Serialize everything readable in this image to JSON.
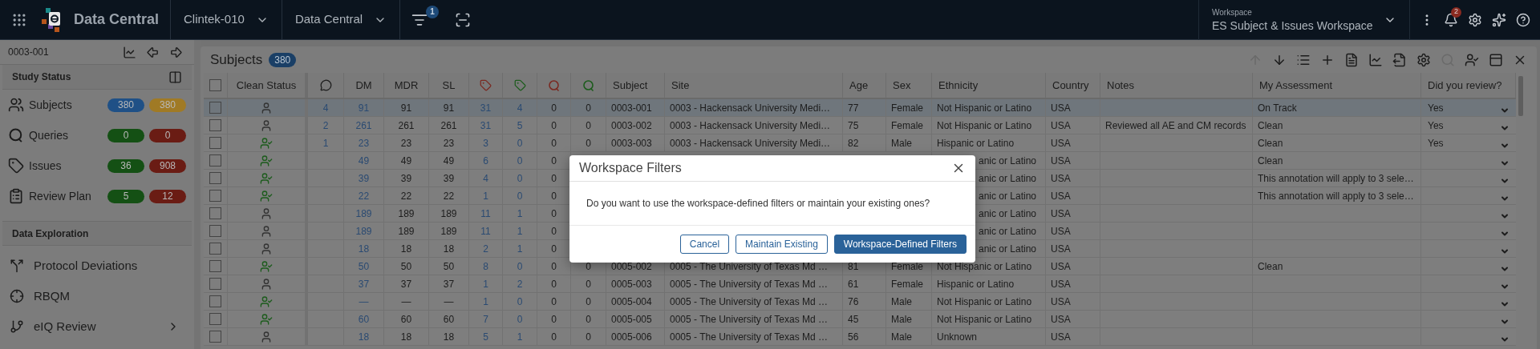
{
  "top_bar": {
    "app_name": "Data Central",
    "selectors": [
      {
        "label": "Clintek-010"
      },
      {
        "label": "Data Central"
      }
    ],
    "filter_badge": "1",
    "workspace": {
      "caption": "Workspace",
      "value": "ES Subject & Issues Workspace"
    },
    "notification_badge": "2"
  },
  "sidebar": {
    "subject_id": "0003-001",
    "sections": [
      {
        "title": "Study Status",
        "kind": "status",
        "items": [
          {
            "label": "Subjects",
            "counts": [
              {
                "value": "380",
                "color": "#1f5086"
              },
              {
                "value": "380",
                "color": "#a07a25"
              }
            ]
          },
          {
            "label": "Queries",
            "counts": [
              {
                "value": "0",
                "color": "#145014"
              },
              {
                "value": "0",
                "color": "#6a1c14"
              }
            ]
          },
          {
            "label": "Issues",
            "counts": [
              {
                "value": "36",
                "color": "#145014"
              },
              {
                "value": "908",
                "color": "#6a1c14"
              }
            ]
          },
          {
            "label": "Review Plan",
            "counts": [
              {
                "value": "5",
                "color": "#145014"
              },
              {
                "value": "12",
                "color": "#6a1c14"
              }
            ]
          }
        ]
      },
      {
        "title": "Data Exploration",
        "kind": "nav",
        "items": [
          {
            "label": "Protocol Deviations",
            "has_children": false
          },
          {
            "label": "RBQM",
            "has_children": false
          },
          {
            "label": "eIQ Review",
            "has_children": true
          }
        ]
      }
    ]
  },
  "panel": {
    "title": "Subjects",
    "count": "380",
    "all_checked": false,
    "columns": [
      {
        "kind": "text",
        "label": "Clean Status"
      },
      {
        "kind": "comment"
      },
      {
        "kind": "text",
        "label": "DM"
      },
      {
        "kind": "text",
        "label": "MDR"
      },
      {
        "kind": "text",
        "label": "SL"
      },
      {
        "kind": "tag",
        "color": "#7a2a22"
      },
      {
        "kind": "tag",
        "color": "#1d5c1d"
      },
      {
        "kind": "query",
        "color": "#7a2a22"
      },
      {
        "kind": "query",
        "color": "#1d5c1d"
      },
      {
        "kind": "text",
        "label": "Subject"
      },
      {
        "kind": "text",
        "label": "Site"
      },
      {
        "kind": "text",
        "label": "Age"
      },
      {
        "kind": "text",
        "label": "Sex"
      },
      {
        "kind": "text",
        "label": "Ethnicity"
      },
      {
        "kind": "text",
        "label": "Country"
      },
      {
        "kind": "text",
        "label": "Notes"
      },
      {
        "kind": "text",
        "label": "My Assessment"
      },
      {
        "kind": "text",
        "label": "Did you review?"
      }
    ],
    "rows": [
      {
        "selected": true,
        "clean": false,
        "covered": false,
        "comments": "4",
        "dm": "91",
        "mdr": "91",
        "sl": "91",
        "tags_1": "31",
        "tags_2": "4",
        "queries_1": "0",
        "queries_2": "0",
        "subject": "0003-001",
        "site": "0003 - Hackensack University Medi…",
        "age": "77",
        "sex": "Female",
        "ethnicity": "Not Hispanic or Latino",
        "country": "USA",
        "assessment": "On Track",
        "review": "Yes"
      },
      {
        "selected": false,
        "clean": false,
        "covered": false,
        "comments": "2",
        "dm": "261",
        "mdr": "261",
        "sl": "261",
        "tags_1": "31",
        "tags_2": "5",
        "queries_1": "0",
        "queries_2": "0",
        "subject": "0003-002",
        "site": "0003 - Hackensack University Medi…",
        "age": "75",
        "sex": "Female",
        "ethnicity": "Not Hispanic or Latino",
        "country": "USA",
        "notes": "Reviewed all AE and CM records",
        "assessment": "Clean",
        "review": "Yes"
      },
      {
        "selected": false,
        "clean": true,
        "covered": false,
        "comments": "1",
        "dm": "23",
        "mdr": "23",
        "sl": "23",
        "tags_1": "3",
        "tags_2": "0",
        "queries_1": "0",
        "queries_2": "0",
        "subject": "0003-003",
        "site": "0003 - Hackensack University Medi…",
        "age": "82",
        "sex": "Male",
        "ethnicity": "Hispanic or Latino",
        "country": "USA",
        "assessment": "Clean",
        "review": "Yes"
      },
      {
        "selected": false,
        "clean": true,
        "covered": true,
        "dm": "49",
        "mdr": "49",
        "sl": "49",
        "tags_1": "6",
        "tags_2": "0",
        "queries_1": "0",
        "ethnicity": "anic or Latino",
        "country": "USA",
        "assessment": "Clean"
      },
      {
        "selected": false,
        "clean": true,
        "covered": true,
        "dm": "39",
        "mdr": "39",
        "sl": "39",
        "tags_1": "4",
        "tags_2": "0",
        "queries_1": "0",
        "ethnicity": "anic or Latino",
        "country": "USA",
        "assessment": "This annotation will apply to 3 sele…"
      },
      {
        "selected": false,
        "clean": true,
        "covered": true,
        "dm": "22",
        "mdr": "22",
        "sl": "22",
        "tags_1": "1",
        "tags_2": "0",
        "queries_1": "0",
        "ethnicity": "anic or Latino",
        "country": "USA",
        "assessment": "This annotation will apply to 3 sele…"
      },
      {
        "selected": false,
        "clean": false,
        "covered": true,
        "dm": "189",
        "mdr": "189",
        "sl": "189",
        "tags_1": "11",
        "tags_2": "1",
        "queries_1": "0",
        "ethnicity": "anic or Latino",
        "country": "USA"
      },
      {
        "selected": false,
        "clean": false,
        "covered": true,
        "dm": "189",
        "mdr": "189",
        "sl": "189",
        "tags_1": "11",
        "tags_2": "1",
        "queries_1": "0",
        "ethnicity": "anic or Latino",
        "country": "USA"
      },
      {
        "selected": false,
        "clean": false,
        "covered": true,
        "dm": "18",
        "mdr": "18",
        "sl": "18",
        "tags_1": "2",
        "tags_2": "1",
        "queries_1": "0",
        "ethnicity": "anic or Latino",
        "country": "USA"
      },
      {
        "selected": false,
        "clean": true,
        "covered": false,
        "dm": "50",
        "mdr": "50",
        "sl": "50",
        "tags_1": "8",
        "tags_2": "0",
        "queries_1": "0",
        "queries_2": "0",
        "subject": "0005-002",
        "site": "0005 - The University of Texas Md …",
        "age": "81",
        "sex": "Female",
        "ethnicity": "Not Hispanic or Latino",
        "country": "USA",
        "assessment": "Clean"
      },
      {
        "selected": false,
        "clean": false,
        "covered": false,
        "dm": "37",
        "mdr": "37",
        "sl": "37",
        "tags_1": "1",
        "tags_2": "2",
        "queries_1": "0",
        "queries_2": "0",
        "subject": "0005-003",
        "site": "0005 - The University of Texas Md …",
        "age": "61",
        "sex": "Female",
        "ethnicity": "Hispanic or Latino",
        "country": "USA"
      },
      {
        "selected": false,
        "clean": true,
        "covered": false,
        "dm": "—",
        "mdr": "—",
        "sl": "—",
        "tags_1": "1",
        "tags_2": "0",
        "queries_1": "0",
        "queries_2": "0",
        "subject": "0005-004",
        "site": "0005 - The University of Texas Md …",
        "age": "76",
        "sex": "Male",
        "ethnicity": "Not Hispanic or Latino",
        "country": "USA"
      },
      {
        "selected": false,
        "clean": true,
        "covered": false,
        "dm": "60",
        "mdr": "60",
        "sl": "60",
        "tags_1": "7",
        "tags_2": "0",
        "queries_1": "0",
        "queries_2": "0",
        "subject": "0005-005",
        "site": "0005 - The University of Texas Md …",
        "age": "45",
        "sex": "Male",
        "ethnicity": "Not Hispanic or Latino",
        "country": "USA"
      },
      {
        "selected": false,
        "clean": false,
        "covered": false,
        "dm": "18",
        "mdr": "18",
        "sl": "18",
        "tags_1": "5",
        "tags_2": "1",
        "queries_1": "0",
        "queries_2": "0",
        "subject": "0005-006",
        "site": "0005 - The University of Texas Md …",
        "age": "56",
        "sex": "Male",
        "ethnicity": "Unknown",
        "country": "USA"
      }
    ]
  },
  "dialog": {
    "title": "Workspace Filters",
    "message": "Do you want to use the workspace-defined filters or maintain your existing ones?",
    "buttons": [
      {
        "label": "Cancel",
        "kind": "outline"
      },
      {
        "label": "Maintain Existing",
        "kind": "outline"
      },
      {
        "label": "Workspace-Defined Filters",
        "kind": "primary"
      }
    ]
  }
}
